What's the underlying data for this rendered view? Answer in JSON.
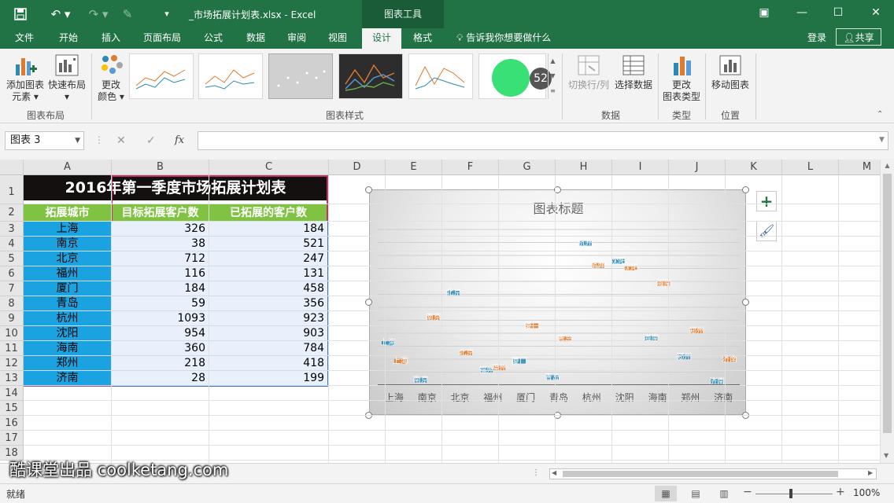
{
  "app": {
    "doc_title": "_市场拓展计划表.xlsx - Excel",
    "context_title": "图表工具",
    "accent": "#217346"
  },
  "tabs": [
    {
      "label": "文件"
    },
    {
      "label": "开始"
    },
    {
      "label": "插入"
    },
    {
      "label": "页面布局"
    },
    {
      "label": "公式"
    },
    {
      "label": "数据"
    },
    {
      "label": "审阅"
    },
    {
      "label": "视图"
    },
    {
      "label": "设计",
      "active": true
    },
    {
      "label": "格式"
    }
  ],
  "tell_me": "告诉我你想要做什么",
  "login": "登录",
  "share": "共享",
  "ribbon": {
    "add_element": [
      "添加图表",
      "元素 ▾"
    ],
    "quick_layout": [
      "快速布局",
      "▾"
    ],
    "change_colors": [
      "更改",
      "颜色 ▾"
    ],
    "switch_row_col": "切换行/列",
    "select_data": "选择数据",
    "change_type": [
      "更改",
      "图表类型"
    ],
    "move_chart": "移动图表",
    "groups": {
      "layout": "图表布局",
      "styles": "图表样式",
      "data": "数据",
      "type": "类型",
      "location": "位置"
    },
    "click_count": "52"
  },
  "formula_bar": {
    "name_box": "图表 3",
    "cancel": "✕",
    "enter": "✓",
    "fx": "fx",
    "formula": ""
  },
  "columns": [
    "A",
    "B",
    "C",
    "D",
    "E",
    "F",
    "G",
    "H",
    "I",
    "J",
    "K",
    "L",
    "M"
  ],
  "rows": [
    "1",
    "2",
    "3",
    "4",
    "5",
    "6",
    "7",
    "8",
    "9",
    "10",
    "11",
    "12",
    "13",
    "14",
    "15",
    "16",
    "17",
    "18"
  ],
  "sheet": {
    "title": "2016年第一季度市场拓展计划表",
    "headers": [
      "拓展城市",
      "目标拓展客户数",
      "已拓展的客户数"
    ],
    "data": [
      [
        "上海",
        "326",
        "184"
      ],
      [
        "南京",
        "38",
        "521"
      ],
      [
        "北京",
        "712",
        "247"
      ],
      [
        "福州",
        "116",
        "131"
      ],
      [
        "厦门",
        "184",
        "458"
      ],
      [
        "青岛",
        "59",
        "356"
      ],
      [
        "杭州",
        "1093",
        "923"
      ],
      [
        "沈阳",
        "954",
        "903"
      ],
      [
        "海南",
        "360",
        "784"
      ],
      [
        "郑州",
        "218",
        "418"
      ],
      [
        "济南",
        "28",
        "199"
      ]
    ]
  },
  "chart": {
    "title": "图表标题"
  },
  "chart_data": {
    "type": "scatter",
    "title": "图表标题",
    "categories": [
      "上海",
      "南京",
      "北京",
      "福州",
      "厦门",
      "青岛",
      "杭州",
      "沈阳",
      "海南",
      "郑州",
      "济南"
    ],
    "series": [
      {
        "name": "目标拓展客户数",
        "values": [
          326,
          38,
          712,
          116,
          184,
          59,
          1093,
          954,
          360,
          218,
          28
        ],
        "color": "#2e8ab3"
      },
      {
        "name": "已拓展的客户数",
        "values": [
          184,
          521,
          247,
          131,
          458,
          356,
          923,
          903,
          784,
          418,
          199
        ],
        "color": "#e07b2c"
      }
    ],
    "ylim": [
      0,
      1200
    ],
    "grid": true,
    "legend": "none"
  },
  "status": {
    "ready": "就绪",
    "zoom": "100%",
    "minus": "−",
    "plus": "+"
  },
  "watermark": "酷课堂出品 coolketang.com"
}
